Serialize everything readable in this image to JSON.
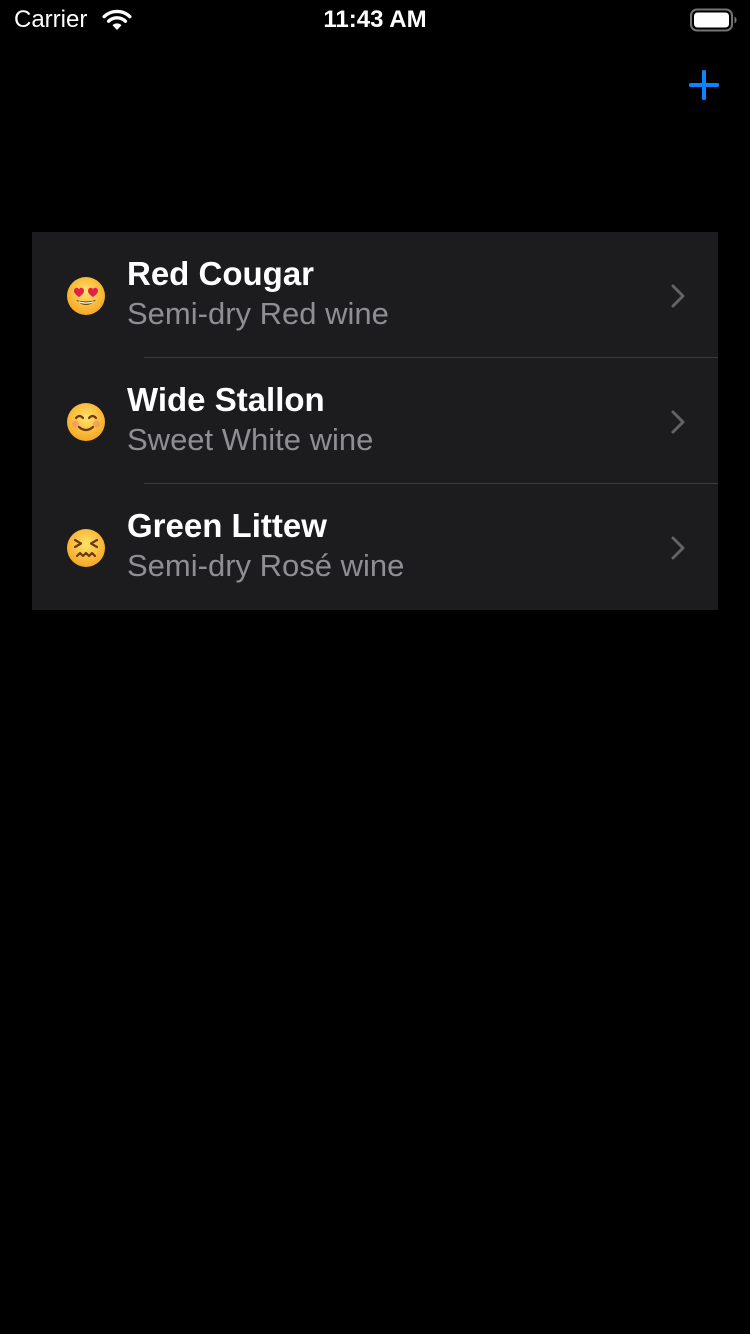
{
  "status_bar": {
    "carrier": "Carrier",
    "time": "11:43 AM"
  },
  "nav_bar": {
    "add_icon": "plus-icon",
    "accent_color": "#0a84ff"
  },
  "wines": [
    {
      "name": "Red Cougar",
      "description": "Semi-dry Red wine",
      "emoji": "smiling-face-with-heart-eyes-icon"
    },
    {
      "name": "Wide Stallon",
      "description": "Sweet White wine",
      "emoji": "smiling-face-with-smiling-eyes-icon"
    },
    {
      "name": "Green Littew",
      "description": "Semi-dry Rosé wine",
      "emoji": "confounded-face-icon"
    }
  ],
  "colors": {
    "background": "#000000",
    "cell_background": "#1c1c1e",
    "secondary_text": "#8e8e93",
    "separator": "#3a3a3c",
    "chevron": "#636366"
  }
}
